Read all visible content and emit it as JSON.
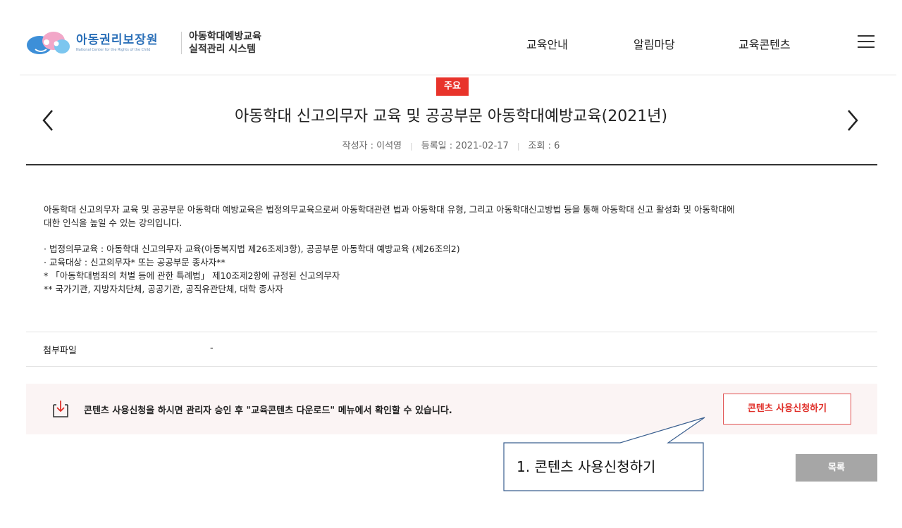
{
  "header": {
    "logo_name": "아동권리보장원",
    "logo_subtitle": "National Center for the Rights of the Child",
    "system_line1": "아동학대예방교육",
    "system_line2": "실적관리 시스템",
    "nav": [
      "교육안내",
      "알림마당",
      "교육콘텐츠"
    ],
    "menu_icon": "hamburger-menu-icon"
  },
  "post": {
    "badge": "주요",
    "title": "아동학대 신고의무자 교육 및 공공부문 아동학대예방교육(2021년)",
    "author": "작성자 : 이석영",
    "date": "등록일 : 2021-02-17",
    "views": "조회 : 6",
    "body": [
      "아동학대 신고의무자 교육 및 공공부문 아동학대 예방교육은 법정의무교육으로써 아동학대관련 법과 아동학대 유형, 그리고 아동학대신고방법 등을 통해 아동학대 신고 활성화 및 아동학대에",
      "대한 인식을 높일 수 있는 강의입니다."
    ],
    "bullets": [
      "· 법정의무교육 : 아동학대 신고의무자 교육(아동복지법 제26조제3항), 공공부문 아동학대 예방교육 (제26조의2)",
      "· 교육대상 : 신고의무자* 또는 공공부문 종사자**",
      "* 「아동학대범죄의 처벌 등에 관한 특례법」 제10조제2항에 규정된 신고의무자",
      "** 국가기관, 지방자치단체, 공공기관, 공직유관단체, 대학 종사자"
    ],
    "attachment_label": "첨부파일",
    "attachment_value": "-"
  },
  "notice": {
    "icon": "download-icon",
    "text": "콘텐츠 사용신청을 하시면 관리자 승인 후 \"교육콘텐츠 다운로드\" 메뉴에서 확인할 수 있습니다.",
    "apply_button": "콘텐츠 사용신청하기"
  },
  "list_button": "목록",
  "callout": "1. 콘텐츠 사용신청하기",
  "colors": {
    "accent_red": "#e8332a",
    "logo_blue": "#2a6fb8",
    "notice_bg": "#fbf4f4",
    "list_button_bg": "#a6a6a6",
    "callout_border": "#3a5f8f"
  }
}
